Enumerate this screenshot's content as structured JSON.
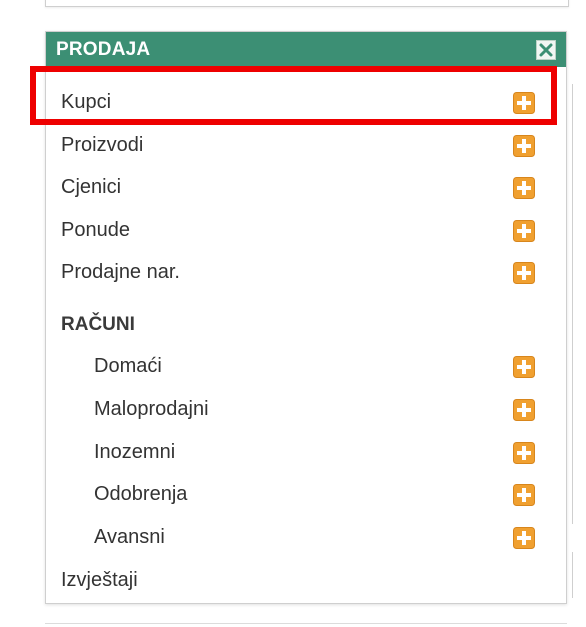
{
  "panel": {
    "title": "PRODAJA",
    "close_icon": "close-icon"
  },
  "menu": {
    "items": [
      {
        "label": "Kupci",
        "icon": "add-icon"
      },
      {
        "label": "Proizvodi",
        "icon": "add-icon"
      },
      {
        "label": "Cjenici",
        "icon": "add-icon"
      },
      {
        "label": "Ponude",
        "icon": "add-icon"
      },
      {
        "label": "Prodajne nar.",
        "icon": "add-icon"
      }
    ],
    "section": {
      "label": "RAČUNI",
      "items": [
        {
          "label": "Domaći",
          "icon": "add-icon"
        },
        {
          "label": "Maloprodajni",
          "icon": "add-icon"
        },
        {
          "label": "Inozemni",
          "icon": "add-icon"
        },
        {
          "label": "Odobrenja",
          "icon": "add-icon"
        },
        {
          "label": "Avansni",
          "icon": "add-icon"
        }
      ]
    },
    "footer_item": {
      "label": "Izvještaji"
    }
  },
  "colors": {
    "header": "#3c8f74",
    "add_icon": "#f0a030",
    "highlight": "#ee0000"
  }
}
